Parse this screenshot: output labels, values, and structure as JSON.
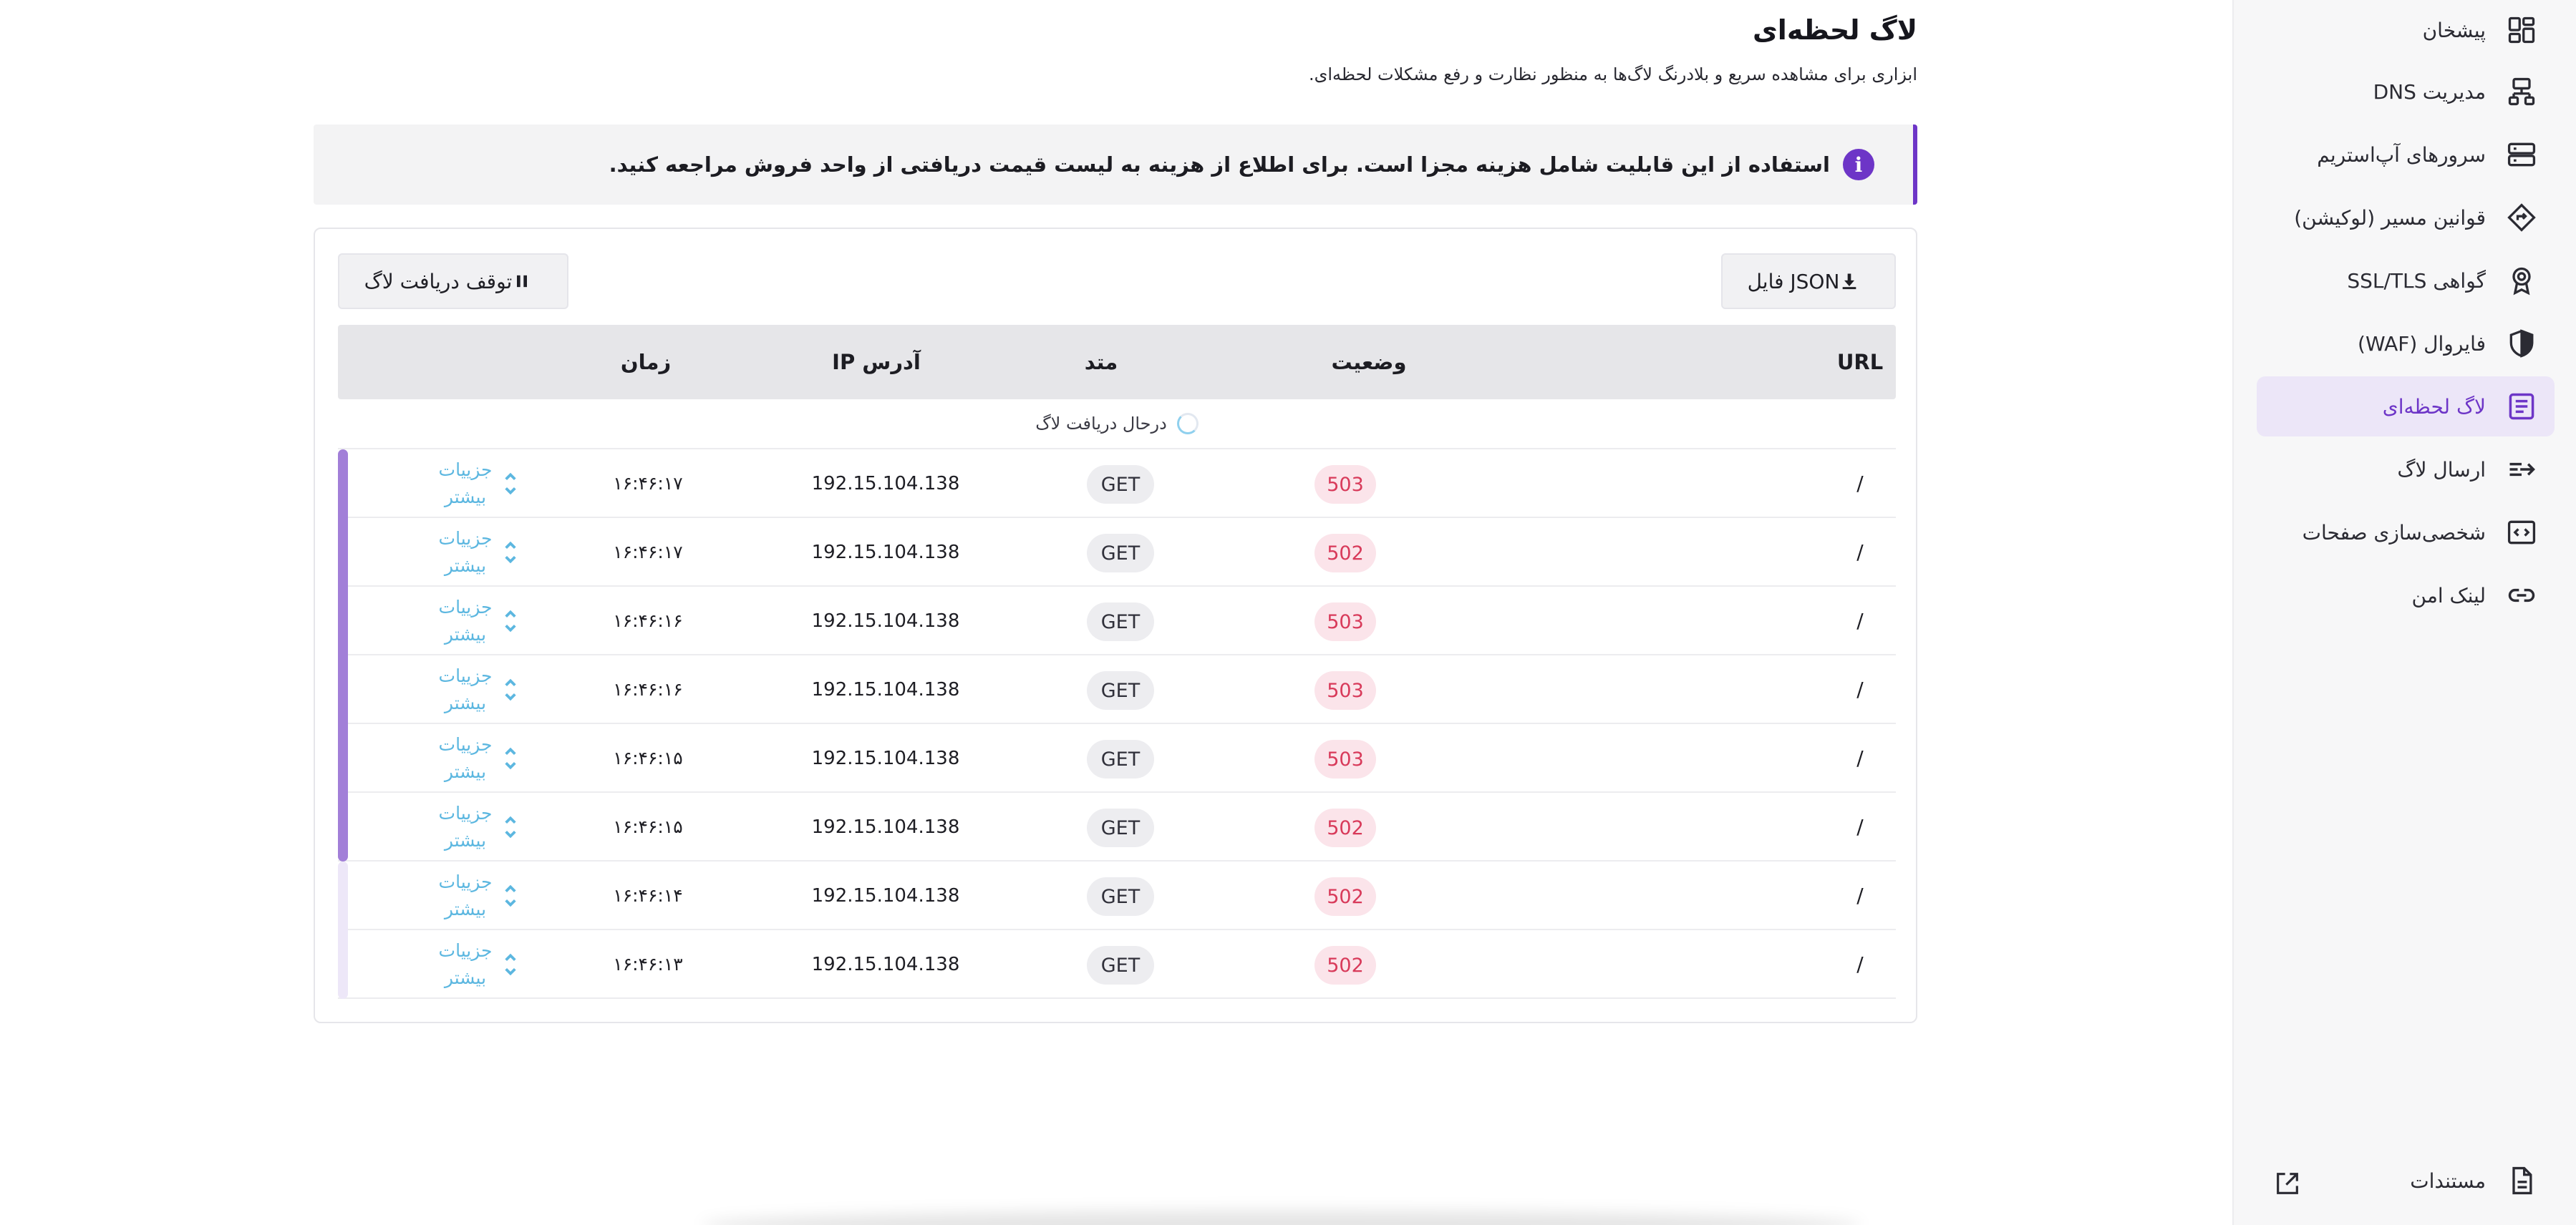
{
  "sidebar": {
    "items": [
      {
        "label": "پیشخان",
        "icon": "dashboard-icon",
        "active": false
      },
      {
        "label": "مدیریت DNS",
        "icon": "dns-network-icon",
        "active": false
      },
      {
        "label": "سرورهای آپ‌استریم",
        "icon": "server-icon",
        "active": false
      },
      {
        "label": "قوانین مسیر (لوکیشن)",
        "icon": "route-diamond-icon",
        "active": false
      },
      {
        "label": "گواهی SSL/TLS",
        "icon": "certificate-badge-icon",
        "active": false
      },
      {
        "label": "فایروال (WAF)",
        "icon": "shield-icon",
        "active": false
      },
      {
        "label": "لاگ لحظه‌ای",
        "icon": "document-log-icon",
        "active": true
      },
      {
        "label": "ارسال لاگ",
        "icon": "send-arrow-icon",
        "active": false
      },
      {
        "label": "شخصی‌سازی صفحات",
        "icon": "code-page-icon",
        "active": false
      },
      {
        "label": "لینک امن",
        "icon": "link-icon",
        "active": false
      }
    ],
    "docs": {
      "label": "مستندات",
      "icon": "document-icon",
      "external_icon": "external-link-icon"
    }
  },
  "header": {
    "title": "لاگ لحظه‌ای",
    "subtitle": "ابزاری برای مشاهده سریع و بلادرنگ لاگ‌ها به منظور نظارت و رفع مشکلات لحظه‌ای."
  },
  "notice": {
    "text": "استفاده از این قابلیت شامل هزینه مجزا است. برای اطلاع از هزینه به لیست قیمت دریافتی از واحد فروش مراجعه کنید.",
    "icon": "info-icon",
    "accent": "#6d35c7"
  },
  "toolbar": {
    "json_label": "فایل JSON",
    "stop_label": "توقف دریافت لاگ"
  },
  "table": {
    "columns": {
      "url": "URL",
      "status": "وضعیت",
      "method": "متد",
      "ip": "آدرس IP",
      "time": "زمان"
    },
    "loading_text": "درحال دریافت لاگ",
    "details_label": "جزییات بیشتر",
    "rows": [
      {
        "url": "/",
        "status": "503",
        "method": "GET",
        "ip": "192.15.104.138",
        "time": "۱۶:۴۶:۱۷"
      },
      {
        "url": "/",
        "status": "502",
        "method": "GET",
        "ip": "192.15.104.138",
        "time": "۱۶:۴۶:۱۷"
      },
      {
        "url": "/",
        "status": "503",
        "method": "GET",
        "ip": "192.15.104.138",
        "time": "۱۶:۴۶:۱۶"
      },
      {
        "url": "/",
        "status": "503",
        "method": "GET",
        "ip": "192.15.104.138",
        "time": "۱۶:۴۶:۱۶"
      },
      {
        "url": "/",
        "status": "503",
        "method": "GET",
        "ip": "192.15.104.138",
        "time": "۱۶:۴۶:۱۵"
      },
      {
        "url": "/",
        "status": "502",
        "method": "GET",
        "ip": "192.15.104.138",
        "time": "۱۶:۴۶:۱۵"
      },
      {
        "url": "/",
        "status": "502",
        "method": "GET",
        "ip": "192.15.104.138",
        "time": "۱۶:۴۶:۱۴"
      },
      {
        "url": "/",
        "status": "502",
        "method": "GET",
        "ip": "192.15.104.138",
        "time": "۱۶:۴۶:۱۳"
      }
    ]
  },
  "colors": {
    "accent": "#6d35c7",
    "status_error_bg": "#fbe4ea",
    "status_error_text": "#d83a5a",
    "details_link": "#5cb7e0"
  }
}
